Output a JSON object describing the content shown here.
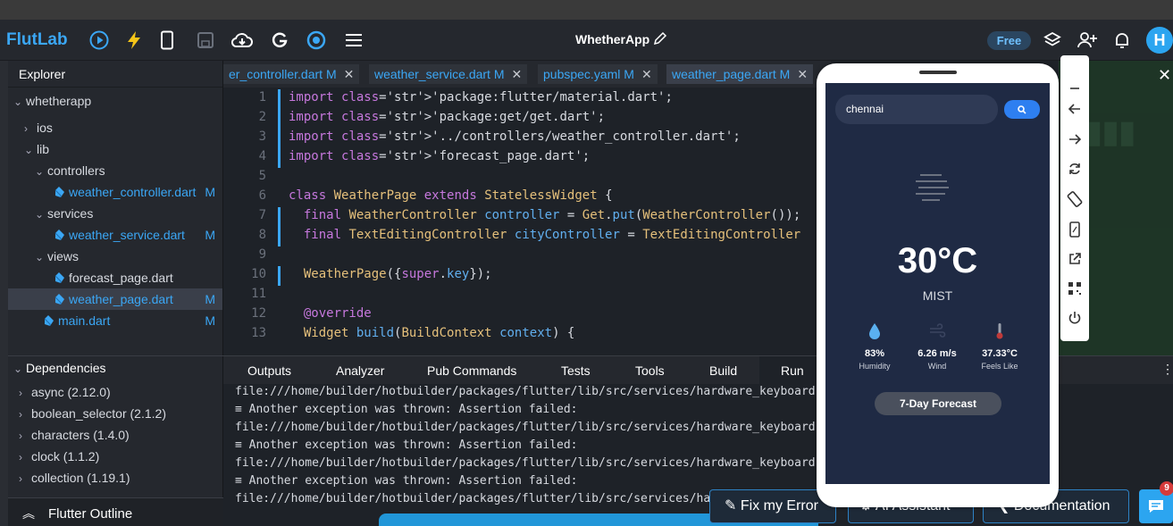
{
  "app": {
    "brand": "FlutLab",
    "project": "WhetherApp",
    "plan": "Free",
    "avatar_initial": "H"
  },
  "sidebar": {
    "title": "Explorer",
    "tree": [
      {
        "label": "whetherapp",
        "type": "folder-open",
        "depth": 0,
        "mark": ""
      },
      {
        "label": "ios",
        "type": "folder",
        "depth": 1,
        "mark": ""
      },
      {
        "label": "lib",
        "type": "folder-open",
        "depth": 1,
        "mark": ""
      },
      {
        "label": "controllers",
        "type": "folder-open",
        "depth": 2,
        "mark": ""
      },
      {
        "label": "weather_controller.dart",
        "type": "dart",
        "depth": 3,
        "mark": "M"
      },
      {
        "label": "services",
        "type": "folder-open",
        "depth": 2,
        "mark": ""
      },
      {
        "label": "weather_service.dart",
        "type": "dart",
        "depth": 3,
        "mark": "M"
      },
      {
        "label": "views",
        "type": "folder-open",
        "depth": 2,
        "mark": ""
      },
      {
        "label": "forecast_page.dart",
        "type": "dart-plain",
        "depth": 3,
        "mark": ""
      },
      {
        "label": "weather_page.dart",
        "type": "dart",
        "depth": 3,
        "mark": "M",
        "selected": true
      },
      {
        "label": "main.dart",
        "type": "dart",
        "depth": 2,
        "mark": "M"
      }
    ],
    "deps_title": "Dependencies",
    "deps": [
      "async (2.12.0)",
      "boolean_selector (2.1.2)",
      "characters (1.4.0)",
      "clock (1.1.2)",
      "collection (1.19.1)"
    ],
    "outline_title": "Flutter Outline"
  },
  "tabs": [
    {
      "label": "er_controller.dart M"
    },
    {
      "label": "weather_service.dart M"
    },
    {
      "label": "pubspec.yaml M"
    },
    {
      "label": "weather_page.dart M"
    }
  ],
  "editor": {
    "line_numbers": [
      "1",
      "2",
      "3",
      "4",
      "5",
      "6",
      "7",
      "8",
      "9",
      "10",
      "11",
      "12",
      "13"
    ],
    "lines": [
      "import 'package:flutter/material.dart';",
      "import 'package:get/get.dart';",
      "import '../controllers/weather_controller.dart';",
      "import 'forecast_page.dart';",
      "",
      "class WeatherPage extends StatelessWidget {",
      "  final WeatherController controller = Get.put(WeatherController());",
      "  final TextEditingController cityController = TextEditingController",
      "",
      "  WeatherPage({super.key});",
      "",
      "  @override",
      "  Widget build(BuildContext context) {"
    ]
  },
  "panel": {
    "tabs": [
      "Outputs",
      "Analyzer",
      "Pub Commands",
      "Tests",
      "Tools",
      "Build",
      "Run"
    ],
    "active": "Run",
    "console": [
      "file:///home/builder/hotbuilder/packages/flutter/lib/src/services/hardware_keyboard.",
      "≡ Another exception was thrown: Assertion failed:",
      "file:///home/builder/hotbuilder/packages/flutter/lib/src/services/hardware_keyboard.",
      "≡ Another exception was thrown: Assertion failed:",
      "file:///home/builder/hotbuilder/packages/flutter/lib/src/services/hardware_keyboard.",
      "≡ Another exception was thrown: Assertion failed:",
      "file:///home/builder/hotbuilder/packages/flutter/lib/src/services/hardware_keyboard."
    ]
  },
  "bottom": {
    "fix_error": "Fix my Error",
    "ai_assistant": "AI Assistant",
    "documentation": "Documentation",
    "notif_count": "9"
  },
  "phone": {
    "search_value": "chennai",
    "temperature": "30°C",
    "condition": "MIST",
    "stats": [
      {
        "value": "83%",
        "label": "Humidity",
        "icon": "droplet-icon"
      },
      {
        "value": "6.26 m/s",
        "label": "Wind",
        "icon": "wind-icon"
      },
      {
        "value": "37.33°C",
        "label": "Feels Like",
        "icon": "thermometer-icon"
      }
    ],
    "forecast_button": "7-Day Forecast"
  }
}
